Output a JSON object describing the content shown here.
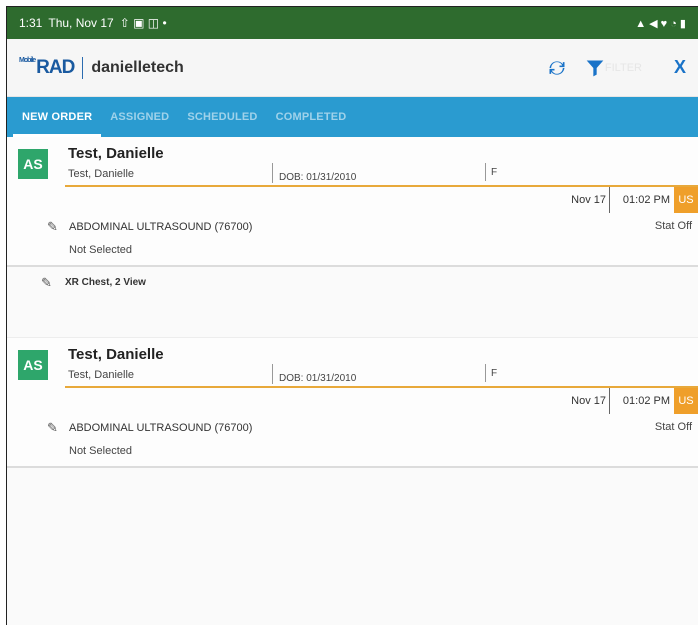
{
  "status_bar": {
    "time": "1:31",
    "date": "Thu, Nov 17",
    "notif_icons": "⇧ ▣ ◫ •",
    "right_icons": "▲ ◀ ♥ ◔ ▮"
  },
  "app": {
    "logo_small": "Mobile",
    "logo_text": "RAD",
    "username": "danielletech",
    "filter_hint": "FILTER",
    "close_label": "X"
  },
  "tabs": [
    {
      "label": "NEW ORDER",
      "active": true
    },
    {
      "label": "ASSIGNED",
      "active": false
    },
    {
      "label": "SCHEDULED",
      "active": false
    },
    {
      "label": "COMPLETED",
      "active": false
    }
  ],
  "orders": [
    {
      "avatar": "AS",
      "name": "Test, Danielle",
      "subname": "Test, Danielle",
      "dob": "DOB: 01/31/2010",
      "sex": "F",
      "date": "Nov 17",
      "time": "01:02 PM",
      "modality": "US",
      "exam": "ABDOMINAL ULTRASOUND (76700)",
      "priority": "Stat Off",
      "assignment": "Not Selected"
    },
    {
      "avatar": "AS",
      "name": "Test, Danielle",
      "subname": "Test, Danielle",
      "dob": "DOB: 01/31/2010",
      "sex": "F",
      "date": "Nov 17",
      "time": "01:02 PM",
      "modality": "US",
      "exam": "ABDOMINAL ULTRASOUND (76700)",
      "priority": "Stat Off",
      "assignment": "Not Selected"
    }
  ],
  "extra_exam": {
    "label": "XR Chest, 2 View"
  },
  "colors": {
    "status_bar": "#2e6b2e",
    "tab_bar": "#2a9bd0",
    "avatar": "#2ea66b",
    "accent_rule": "#e8a93b",
    "modality_badge": "#ef9f2a",
    "icon_blue": "#1a73c8"
  }
}
